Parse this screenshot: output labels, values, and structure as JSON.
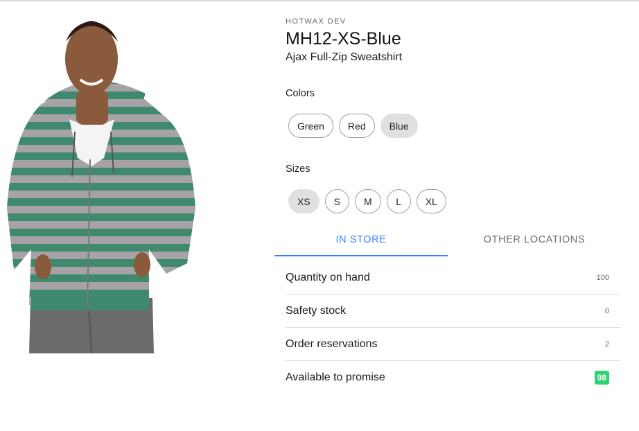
{
  "header": {
    "brand": "HOTWAX DEV",
    "sku": "MH12-XS-Blue",
    "product_name": "Ajax Full-Zip Sweatshirt"
  },
  "image": {
    "icon": "product-photo-striped-hoodie",
    "colors": {
      "stripe_green": "#3f8a6e",
      "stripe_gray": "#a7a2a5",
      "skin": "#8a5a3c",
      "pants": "#6b6b6b"
    }
  },
  "colors_section": {
    "label": "Colors",
    "options": [
      {
        "label": "Green",
        "selected": false
      },
      {
        "label": "Red",
        "selected": false
      },
      {
        "label": "Blue",
        "selected": true
      }
    ]
  },
  "sizes_section": {
    "label": "Sizes",
    "options": [
      {
        "label": "XS",
        "selected": true
      },
      {
        "label": "S",
        "selected": false
      },
      {
        "label": "M",
        "selected": false
      },
      {
        "label": "L",
        "selected": false
      },
      {
        "label": "XL",
        "selected": false
      }
    ]
  },
  "segment": {
    "tabs": [
      {
        "label": "IN STORE",
        "active": true
      },
      {
        "label": "OTHER LOCATIONS",
        "active": false
      }
    ],
    "accent": "#3880ff"
  },
  "inventory": {
    "rows": [
      {
        "label": "Quantity on hand",
        "value": "100"
      },
      {
        "label": "Safety stock",
        "value": "0"
      },
      {
        "label": "Order reservations",
        "value": "2"
      },
      {
        "label": "Available to promise",
        "value": "98",
        "badge_color": "#2dd36f"
      }
    ]
  }
}
